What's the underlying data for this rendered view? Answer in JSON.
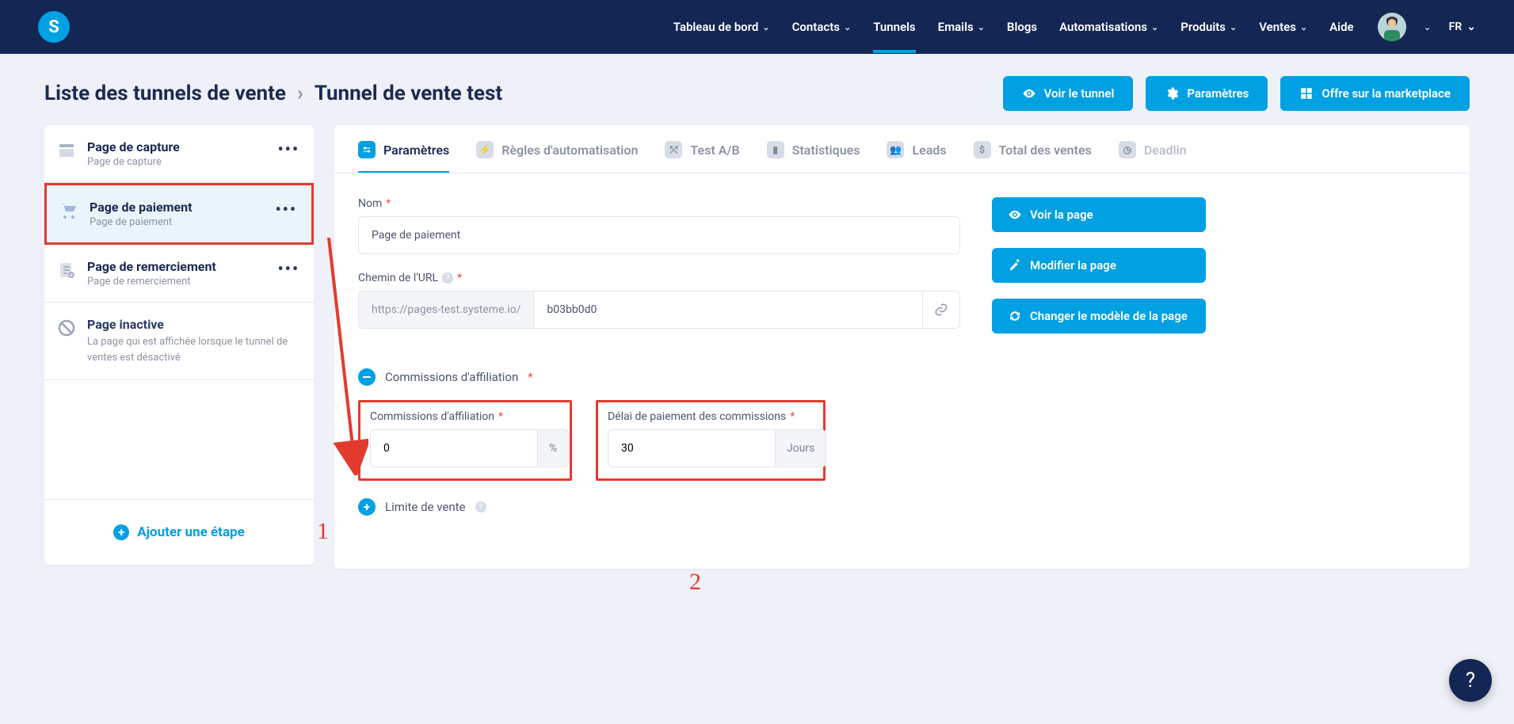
{
  "logo_letter": "S",
  "nav": {
    "items": [
      {
        "label": "Tableau de bord",
        "chev": true,
        "active": false
      },
      {
        "label": "Contacts",
        "chev": true,
        "active": false
      },
      {
        "label": "Tunnels",
        "chev": false,
        "active": true
      },
      {
        "label": "Emails",
        "chev": true,
        "active": false
      },
      {
        "label": "Blogs",
        "chev": false,
        "active": false
      },
      {
        "label": "Automatisations",
        "chev": true,
        "active": false
      },
      {
        "label": "Produits",
        "chev": true,
        "active": false
      },
      {
        "label": "Ventes",
        "chev": true,
        "active": false
      },
      {
        "label": "Aide",
        "chev": false,
        "active": false
      }
    ],
    "lang": "FR"
  },
  "breadcrumb": {
    "root": "Liste des tunnels de vente",
    "current": "Tunnel de vente test"
  },
  "header_buttons": {
    "view": "Voir le tunnel",
    "settings": "Paramètres",
    "marketplace": "Offre sur la marketplace"
  },
  "sidebar": {
    "steps": [
      {
        "title": "Page de capture",
        "sub": "Page de capture"
      },
      {
        "title": "Page de paiement",
        "sub": "Page de paiement"
      },
      {
        "title": "Page de remerciement",
        "sub": "Page de remerciement"
      }
    ],
    "inactive": {
      "title": "Page inactive",
      "desc": "La page qui est affichée lorsque le tunnel de ventes est désactivé"
    },
    "add": "Ajouter une étape"
  },
  "tabs": [
    "Paramètres",
    "Règles d'automatisation",
    "Test A/B",
    "Statistiques",
    "Leads",
    "Total des ventes",
    "Deadlin"
  ],
  "form": {
    "name_label": "Nom",
    "name_value": "Page de paiement",
    "url_label": "Chemin de l'URL",
    "url_prefix": "https://pages-test.systeme.io/",
    "url_value": "b03bb0d0",
    "aff_section": "Commissions d'affiliation",
    "aff_label": "Commissions d'affiliation",
    "aff_value": "0",
    "aff_unit": "%",
    "delay_label": "Délai de paiement des commissions",
    "delay_value": "30",
    "delay_unit": "Jours",
    "limit_section": "Limite de vente"
  },
  "side_buttons": {
    "view_page": "Voir la page",
    "edit_page": "Modifier la page",
    "change_template": "Changer le modèle de la page"
  },
  "annotations": {
    "one": "1",
    "two": "2"
  },
  "help": "?"
}
